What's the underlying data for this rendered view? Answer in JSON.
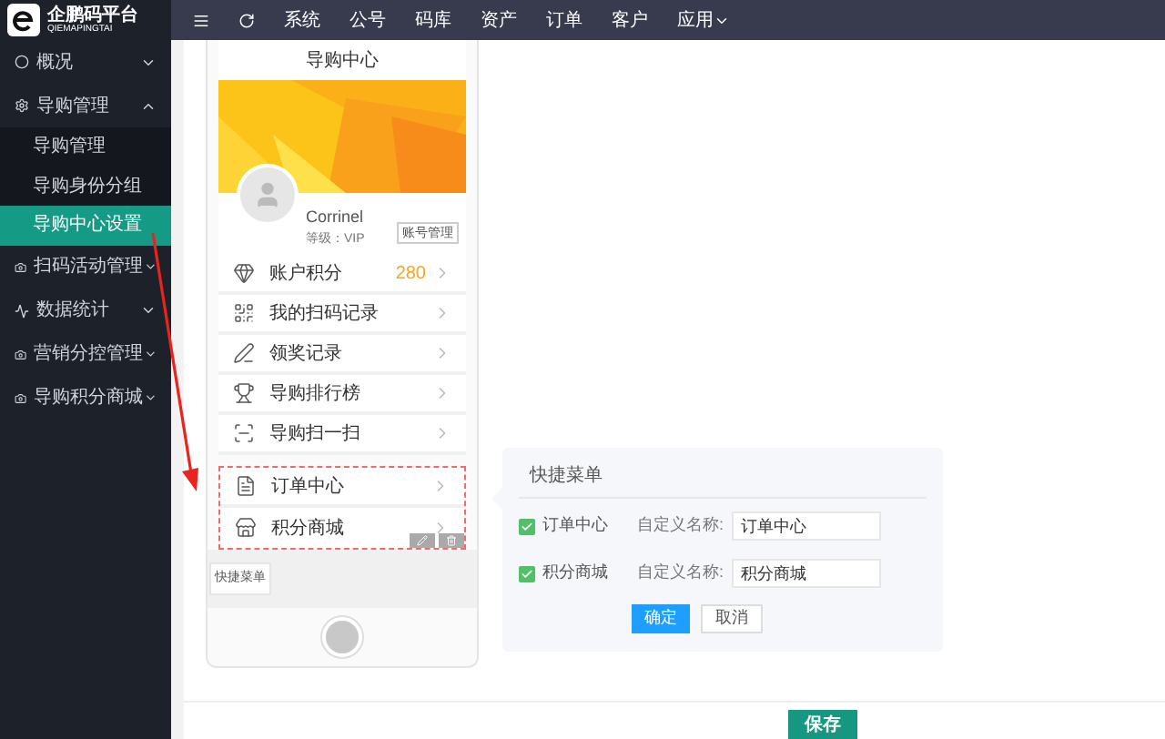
{
  "logo": {
    "name": "企鹏码平台",
    "subtitle": "QIEMAPINGTAI"
  },
  "top_nav": {
    "items": [
      "系统",
      "公号",
      "码库",
      "资产",
      "订单",
      "客户"
    ],
    "dropdown": "应用"
  },
  "sidebar": {
    "items": [
      {
        "label": "概况",
        "expanded": false
      },
      {
        "label": "导购管理",
        "expanded": true,
        "children": [
          {
            "label": "导购管理",
            "selected": false
          },
          {
            "label": "导购身份分组",
            "selected": false
          },
          {
            "label": "导购中心设置",
            "selected": true
          }
        ]
      },
      {
        "label": "扫码活动管理",
        "expanded": false
      },
      {
        "label": "数据统计",
        "expanded": false
      },
      {
        "label": "营销分控管理",
        "expanded": false
      },
      {
        "label": "导购积分商城",
        "expanded": false
      }
    ]
  },
  "phone": {
    "title": "导购中心",
    "user": {
      "name": "Corrinel",
      "level": "等级：VIP",
      "manage_button": "账号管理"
    },
    "rows": [
      {
        "label": "账户积分",
        "value": "280"
      },
      {
        "label": "我的扫码记录"
      },
      {
        "label": "领奖记录"
      },
      {
        "label": "导购排行榜"
      },
      {
        "label": "导购扫一扫"
      }
    ],
    "shortcut_rows": [
      {
        "label": "订单中心"
      },
      {
        "label": "积分商城"
      }
    ],
    "shortcut_button": "快捷菜单"
  },
  "quick_menu": {
    "title": "快捷菜单",
    "items": [
      {
        "label": "订单中心",
        "checked": true,
        "name_label": "自定义名称:",
        "value": "订单中心"
      },
      {
        "label": "积分商城",
        "checked": true,
        "name_label": "自定义名称:",
        "value": "积分商城"
      }
    ],
    "confirm": "确定",
    "cancel": "取消"
  },
  "save_button": "保存"
}
